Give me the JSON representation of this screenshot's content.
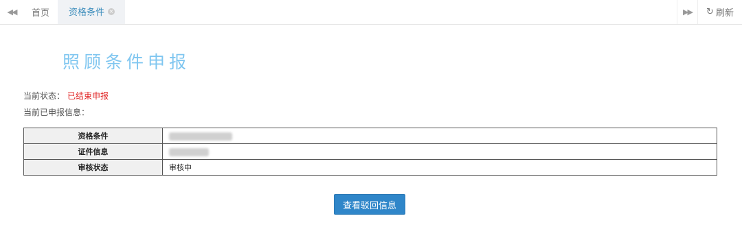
{
  "tabbar": {
    "nav_left_icon": "double-chevron-left-icon",
    "nav_right_icon": "double-chevron-right-icon",
    "tabs": [
      {
        "label": "首页"
      },
      {
        "label": "资格条件"
      }
    ],
    "refresh_label": "刷新",
    "accent_color": "#3c8dbc"
  },
  "page": {
    "title": "照顾条件申报",
    "status_label": "当前状态：",
    "status_value": "已结束申报",
    "status_color": "#e02020",
    "info_label": "当前已申报信息："
  },
  "table": {
    "rows": [
      {
        "label": "资格条件",
        "value": ""
      },
      {
        "label": "证件信息",
        "value": ""
      },
      {
        "label": "审核状态",
        "value": "审核中"
      }
    ]
  },
  "actions": {
    "view_reject_label": "查看驳回信息",
    "button_color": "#2f86c9"
  }
}
